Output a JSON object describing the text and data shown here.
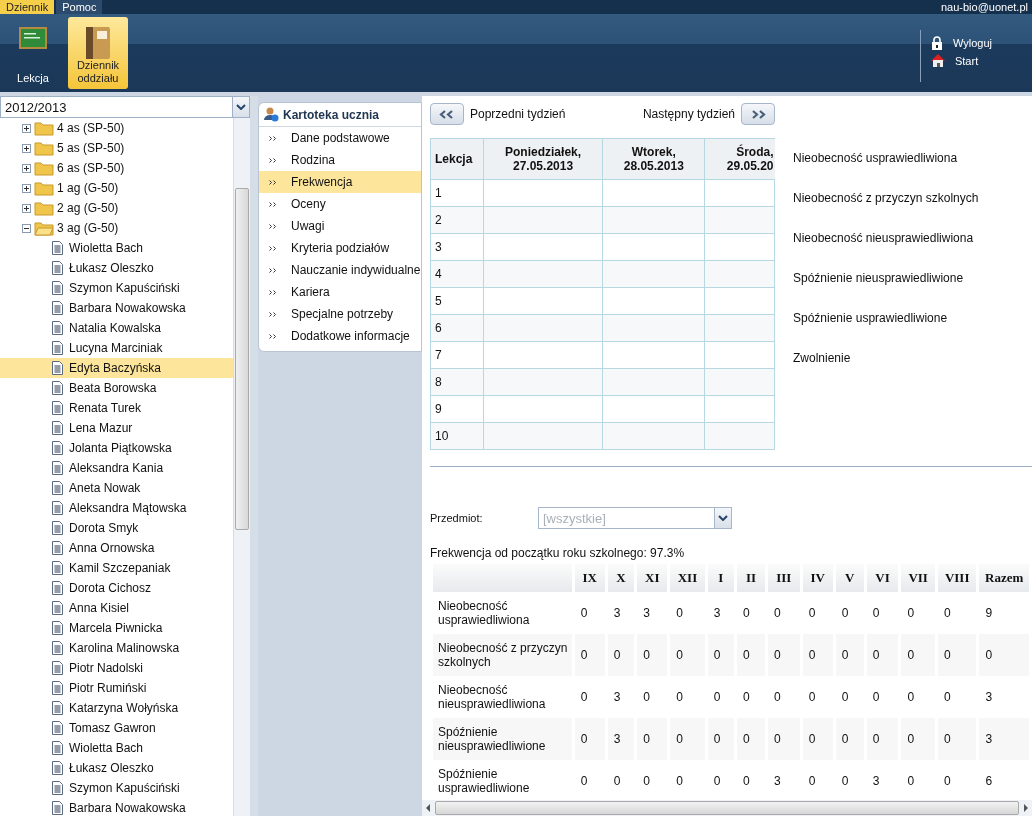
{
  "menu": [
    {
      "label": "Dziennik",
      "selected": true
    },
    {
      "label": "Pomoc",
      "selected": false
    }
  ],
  "user": "nau-bio@uonet.pl",
  "ribbon": [
    {
      "label": "Lekcja",
      "kind": "board",
      "selected": false
    },
    {
      "label": "Dziennik oddziału",
      "kind": "book",
      "selected": true
    }
  ],
  "account_links": [
    {
      "label": "Wyloguj",
      "kind": "lock"
    },
    {
      "label": "Start",
      "kind": "home"
    }
  ],
  "school_year": {
    "value": "2012/2013"
  },
  "tree": [
    {
      "label": "4 as (SP-50)",
      "expanded": false
    },
    {
      "label": "5 as (SP-50)",
      "expanded": false
    },
    {
      "label": "6 as (SP-50)",
      "expanded": false
    },
    {
      "label": "1 ag (G-50)",
      "expanded": false
    },
    {
      "label": "2 ag (G-50)",
      "expanded": false
    },
    {
      "label": "3 ag (G-50)",
      "expanded": true,
      "children": [
        {
          "label": "Wioletta Bach",
          "selected": false
        },
        {
          "label": "Łukasz Oleszko",
          "selected": false
        },
        {
          "label": "Szymon Kapuściński",
          "selected": false
        },
        {
          "label": "Barbara Nowakowska",
          "selected": false
        },
        {
          "label": "Natalia Kowalska",
          "selected": false
        },
        {
          "label": "Lucyna Marciniak",
          "selected": false
        },
        {
          "label": "Edyta Baczyńska",
          "selected": true
        },
        {
          "label": "Beata Borowska",
          "selected": false
        },
        {
          "label": "Renata Turek",
          "selected": false
        },
        {
          "label": "Lena Mazur",
          "selected": false
        },
        {
          "label": "Jolanta Piątkowska",
          "selected": false
        },
        {
          "label": "Aleksandra Kania",
          "selected": false
        },
        {
          "label": "Aneta Nowak",
          "selected": false
        },
        {
          "label": "Aleksandra Mątowska",
          "selected": false
        },
        {
          "label": "Dorota Smyk",
          "selected": false
        },
        {
          "label": "Anna Ornowska",
          "selected": false
        },
        {
          "label": "Kamil Szczepaniak",
          "selected": false
        },
        {
          "label": "Dorota Cichosz",
          "selected": false
        },
        {
          "label": "Anna Kisiel",
          "selected": false
        },
        {
          "label": "Marcela Piwnicka",
          "selected": false
        },
        {
          "label": "Karolina Malinowska",
          "selected": false
        },
        {
          "label": "Piotr Nadolski",
          "selected": false
        },
        {
          "label": "Piotr Rumiński",
          "selected": false
        },
        {
          "label": "Katarzyna Wołyńska",
          "selected": false
        },
        {
          "label": "Tomasz Gawron",
          "selected": false
        },
        {
          "label": "Wioletta Bach",
          "selected": false
        },
        {
          "label": "Łukasz Oleszko",
          "selected": false
        },
        {
          "label": "Szymon Kapuściński",
          "selected": false
        },
        {
          "label": "Barbara Nowakowska",
          "selected": false
        }
      ]
    }
  ],
  "student_card": {
    "title": "Kartoteka ucznia",
    "items": [
      {
        "label": "Dane podstawowe",
        "selected": false
      },
      {
        "label": "Rodzina",
        "selected": false
      },
      {
        "label": "Frekwencja",
        "selected": true
      },
      {
        "label": "Oceny",
        "selected": false
      },
      {
        "label": "Uwagi",
        "selected": false
      },
      {
        "label": "Kryteria podziałów",
        "selected": false
      },
      {
        "label": "Nauczanie indywidualne",
        "selected": false
      },
      {
        "label": "Kariera",
        "selected": false
      },
      {
        "label": "Specjalne potrzeby",
        "selected": false
      },
      {
        "label": "Dodatkowe informacje",
        "selected": false
      }
    ]
  },
  "week_nav": {
    "previous": "Poprzedni tydzień",
    "next": "Następny tydzień"
  },
  "schedule": {
    "first_column": "Lekcja",
    "days": [
      {
        "day": "Poniedziałek,",
        "date": "27.05.2013"
      },
      {
        "day": "Wtorek,",
        "date": "28.05.2013"
      },
      {
        "day": "Środa,",
        "date": "29.05.20"
      }
    ],
    "rows": [
      "1",
      "2",
      "3",
      "4",
      "5",
      "6",
      "7",
      "8",
      "9",
      "10"
    ]
  },
  "legend": [
    "Nieobecność usprawiedliwiona",
    "Nieobecność z przyczyn szkolnych",
    "Nieobecność nieusprawiedliwiona",
    "Spóźnienie nieusprawiedliwione",
    "Spóźnienie usprawiedliwione",
    "Zwolnienie"
  ],
  "subject_filter": {
    "label": "Przedmiot:",
    "value": "[wszystkie]",
    "disabled": true
  },
  "attendance_summary": "Frekwencja od początku roku szkolnego: 97.3%",
  "stats": {
    "columns": [
      "IX",
      "X",
      "XI",
      "XII",
      "I",
      "II",
      "III",
      "IV",
      "V",
      "VI",
      "VII",
      "VIII",
      "Razem"
    ],
    "rows": [
      {
        "label": "Nieobecność usprawiedliwiona",
        "values": [
          "0",
          "3",
          "3",
          "0",
          "3",
          "0",
          "0",
          "0",
          "0",
          "0",
          "0",
          "0",
          "9"
        ]
      },
      {
        "label": "Nieobecność z przyczyn szkolnych",
        "values": [
          "0",
          "0",
          "0",
          "0",
          "0",
          "0",
          "0",
          "0",
          "0",
          "0",
          "0",
          "0",
          "0"
        ]
      },
      {
        "label": "Nieobecność nieusprawiedliwiona",
        "values": [
          "0",
          "3",
          "0",
          "0",
          "0",
          "0",
          "0",
          "0",
          "0",
          "0",
          "0",
          "0",
          "3"
        ]
      },
      {
        "label": "Spóźnienie nieusprawiedliwione",
        "values": [
          "0",
          "3",
          "0",
          "0",
          "0",
          "0",
          "0",
          "0",
          "0",
          "0",
          "0",
          "0",
          "3"
        ]
      },
      {
        "label": "Spóźnienie usprawiedliwione",
        "values": [
          "0",
          "0",
          "0",
          "0",
          "0",
          "0",
          "3",
          "0",
          "0",
          "3",
          "0",
          "0",
          "6"
        ]
      }
    ]
  }
}
